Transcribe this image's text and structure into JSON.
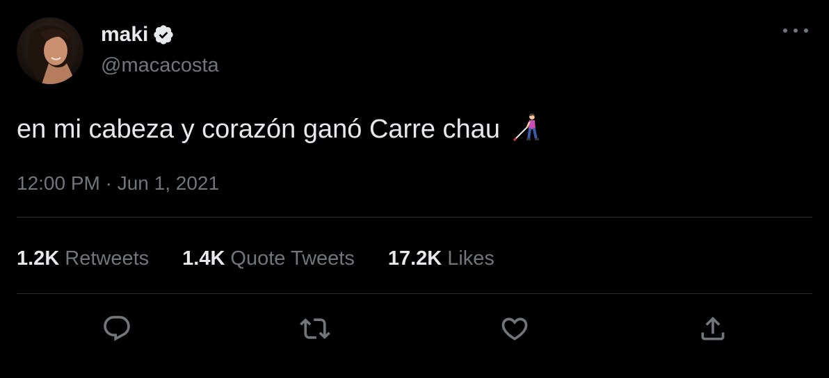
{
  "author": {
    "display_name": "maki",
    "handle": "@macacosta",
    "verified_icon": "verified-badge-icon",
    "avatar_icon": "profile-photo"
  },
  "tweet": {
    "text": "en mi cabeza y corazón ganó Carre chau",
    "emoji": "woman-with-white-cane-emoji",
    "timestamp": "12:00 PM · Jun 1, 2021"
  },
  "stats": [
    {
      "count": "1.2K",
      "label": "Retweets"
    },
    {
      "count": "1.4K",
      "label": "Quote Tweets"
    },
    {
      "count": "17.2K",
      "label": "Likes"
    }
  ],
  "actions": [
    "reply-icon",
    "retweet-icon",
    "like-icon",
    "share-icon"
  ],
  "colors": {
    "background": "#000000",
    "primary_text": "#e7e9ea",
    "secondary_text": "#71767b",
    "divider": "#2f3336"
  }
}
